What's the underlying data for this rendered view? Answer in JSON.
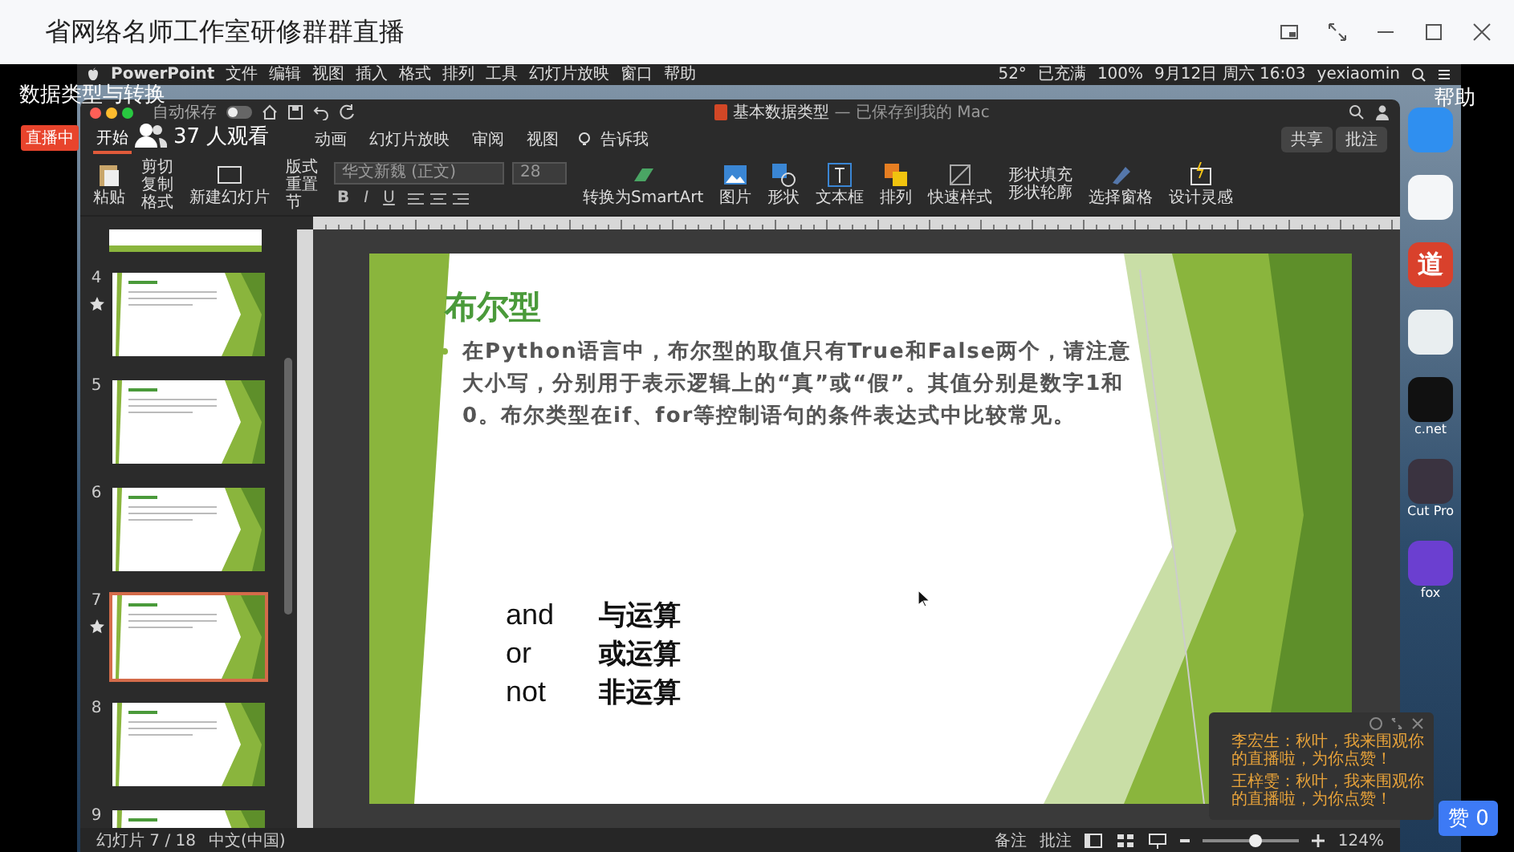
{
  "window": {
    "title": "省网络名师工作室研修群群直播"
  },
  "stream": {
    "title": "数据类型与转换",
    "live_badge": "直播中",
    "viewers": "37 人观看",
    "help": "帮助",
    "like": "赞 0"
  },
  "mac_menu": {
    "app": "PowerPoint",
    "items": [
      "文件",
      "编辑",
      "视图",
      "插入",
      "格式",
      "排列",
      "工具",
      "幻灯片放映",
      "窗口",
      "帮助"
    ],
    "status": [
      "52°",
      "已充满",
      "100%",
      "9月12日 周六 16:03",
      "yexiaomin"
    ]
  },
  "ppt": {
    "autosave": {
      "label": "自动保存",
      "on": false
    },
    "title": "基本数据类型",
    "title_suffix": "— 已保存到我的 Mac",
    "tabs": [
      {
        "label": "开始",
        "selected": true
      },
      {
        "label": "动画",
        "selected": false
      },
      {
        "label": "幻灯片放映",
        "selected": false
      },
      {
        "label": "审阅",
        "selected": false
      },
      {
        "label": "视图",
        "selected": false
      }
    ],
    "tell_me": "告诉我",
    "share": "共享",
    "comments": "批注",
    "ribbon": {
      "paste": "粘贴",
      "clipboard": [
        "剪切",
        "复制",
        "格式"
      ],
      "new_slide": "新建幻灯片",
      "slide_ops": [
        "版式",
        "重置",
        "节"
      ],
      "font": "华文新魏 (正文)",
      "size": "28",
      "format": [
        "B",
        "I",
        "U"
      ],
      "tools": [
        {
          "label": "转换为SmartArt",
          "kind": "smartart"
        },
        {
          "label": "图片",
          "kind": "picture"
        },
        {
          "label": "形状",
          "kind": "shape"
        },
        {
          "label": "文本框",
          "kind": "textbox"
        },
        {
          "label": "排列",
          "kind": "arrange"
        },
        {
          "label": "快速样式",
          "kind": "style"
        }
      ],
      "shape_format": [
        "形状填充",
        "形状轮廓"
      ],
      "pane": "选择窗格",
      "designer": "设计灵感"
    },
    "thumbnails": [
      {
        "number": "4",
        "marked": true,
        "selected": false
      },
      {
        "number": "5",
        "marked": false,
        "selected": false
      },
      {
        "number": "6",
        "marked": false,
        "selected": false
      },
      {
        "number": "7",
        "marked": true,
        "selected": true
      },
      {
        "number": "8",
        "marked": false,
        "selected": false
      },
      {
        "number": "9",
        "selected": false
      }
    ],
    "slide": {
      "title": "布尔型",
      "bullet": "在Python语言中，布尔型的取值只有True和False两个，请注意大小写，分别用于表示逻辑上的“真”或“假”。其值分别是数字1和0。布尔类型在if、for等控制语句的条件表达式中比较常见。",
      "operators": [
        {
          "keyword": "and",
          "meaning": "与运算"
        },
        {
          "keyword": "or",
          "meaning": "或运算"
        },
        {
          "keyword": "not",
          "meaning": "非运算"
        }
      ]
    },
    "status": {
      "slide": "幻灯片 7 / 18",
      "language": "中文(中国)",
      "notes": "备注",
      "comments": "批注",
      "zoom": "124%",
      "zoom_slider": {
        "level": 0.55
      }
    }
  },
  "dock": [
    {
      "color": "#2f8ff0"
    },
    {
      "color": "#f4f6f8"
    },
    {
      "color": "#d9412c",
      "glyph": "道"
    },
    {
      "color": "#e9eef0"
    },
    {
      "color": "#111111",
      "label": "c.net"
    },
    {
      "color": "#3a3340",
      "label": "Cut Pro"
    },
    {
      "color": "#6b3fd0",
      "label": "fox"
    }
  ],
  "chat": {
    "messages": [
      {
        "text": "李宏生：秋叶，我来围观你的直播啦，为你点赞！"
      },
      {
        "text": "王梓雯：秋叶，我来围观你的直播啦，为你点赞！"
      }
    ]
  }
}
